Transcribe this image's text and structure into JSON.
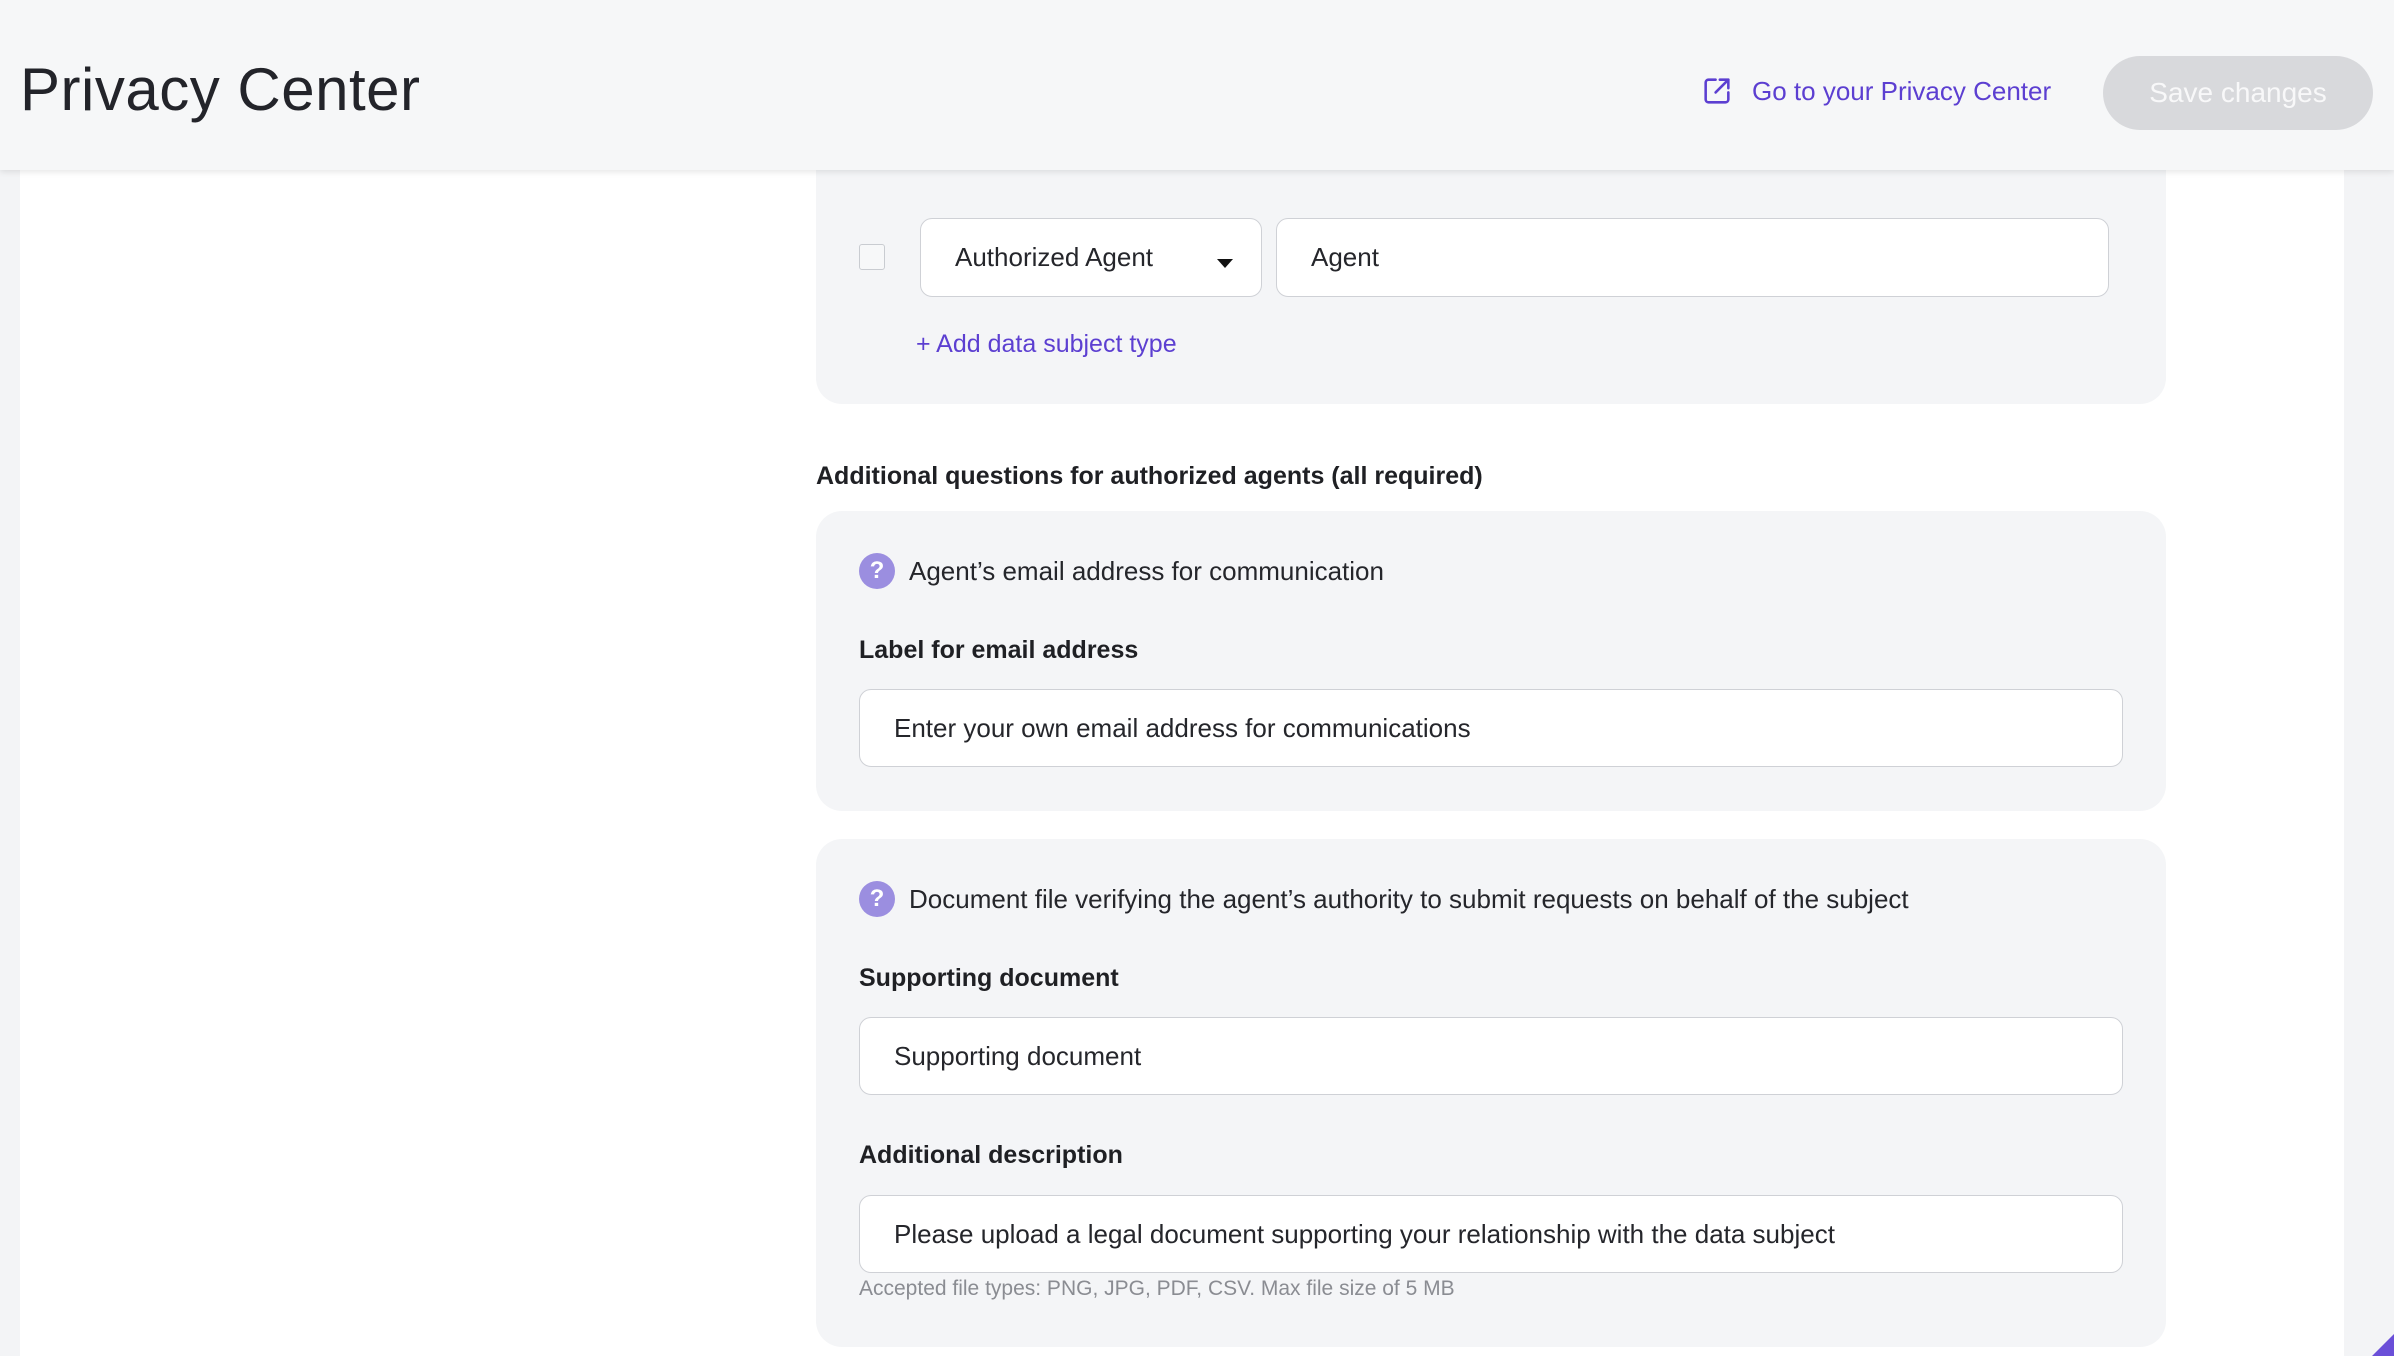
{
  "header": {
    "title": "Privacy Center",
    "link_label": "Go to your Privacy Center",
    "link_icon": "external-link-icon",
    "save_label": "Save changes"
  },
  "data_subjects": {
    "row": {
      "type_selected": "Authorized Agent",
      "display_name": "Agent",
      "checked": false
    },
    "add_label": "+ Add data subject type"
  },
  "agent_questions": {
    "heading": "Additional questions for authorized agents (all required)",
    "email_question": {
      "icon": "question-mark-icon",
      "title": "Agent’s email address for communication",
      "label": "Label for email address",
      "value": "Enter your own email address for communications"
    },
    "document_question": {
      "icon": "question-mark-icon",
      "title": "Document file verifying the agent’s authority to submit requests on behalf of the subject",
      "label": "Supporting document",
      "value": "Supporting document",
      "description_label": "Additional description",
      "description_value": "Please upload a legal document supporting your relationship with the data subject",
      "hint": "Accepted file types: PNG, JPG, PDF, CSV. Max file size of 5 MB"
    }
  },
  "colors": {
    "accent": "#5c3fd1",
    "question_icon": "#9b8ee0",
    "save_disabled": "#d8d9dc"
  }
}
